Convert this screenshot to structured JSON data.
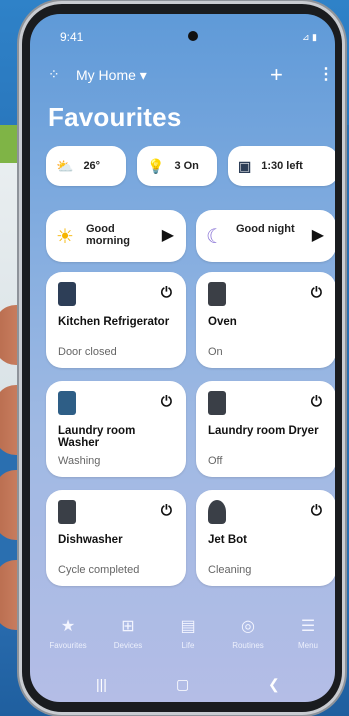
{
  "status": {
    "time": "9:41",
    "signal_battery": "⊿ ▮"
  },
  "header": {
    "home_label": "My Home ▾",
    "add_symbol": "+",
    "more_symbol": "⋮"
  },
  "page": {
    "title": "Favourites"
  },
  "chips": [
    {
      "icon": "cloud-sun-icon",
      "label": "26°"
    },
    {
      "icon": "bulb-icon",
      "label": "3 On"
    },
    {
      "icon": "washer-icon",
      "label": "1:30 left"
    }
  ],
  "routines": [
    {
      "icon": "sun-icon",
      "label": "Good morning"
    },
    {
      "icon": "moon-icon",
      "label": "Good night"
    }
  ],
  "devices": [
    {
      "name": "Kitchen Refrigerator",
      "state": "Door closed"
    },
    {
      "name": "Oven",
      "state": "On"
    },
    {
      "name": "Laundry room Washer",
      "state": "Washing"
    },
    {
      "name": "Laundry room Dryer",
      "state": "Off"
    },
    {
      "name": "Dishwasher",
      "state": "Cycle completed"
    },
    {
      "name": "Jet Bot",
      "state": "Cleaning"
    }
  ],
  "nav": [
    {
      "label": "Favourites",
      "icon": "star-icon"
    },
    {
      "label": "Devices",
      "icon": "devices-icon"
    },
    {
      "label": "Life",
      "icon": "life-icon"
    },
    {
      "label": "Routines",
      "icon": "routines-icon"
    },
    {
      "label": "Menu",
      "icon": "menu-icon"
    }
  ],
  "colors": {
    "accent": "#4a86d0",
    "card": "#ffffff",
    "text": "#111111"
  }
}
